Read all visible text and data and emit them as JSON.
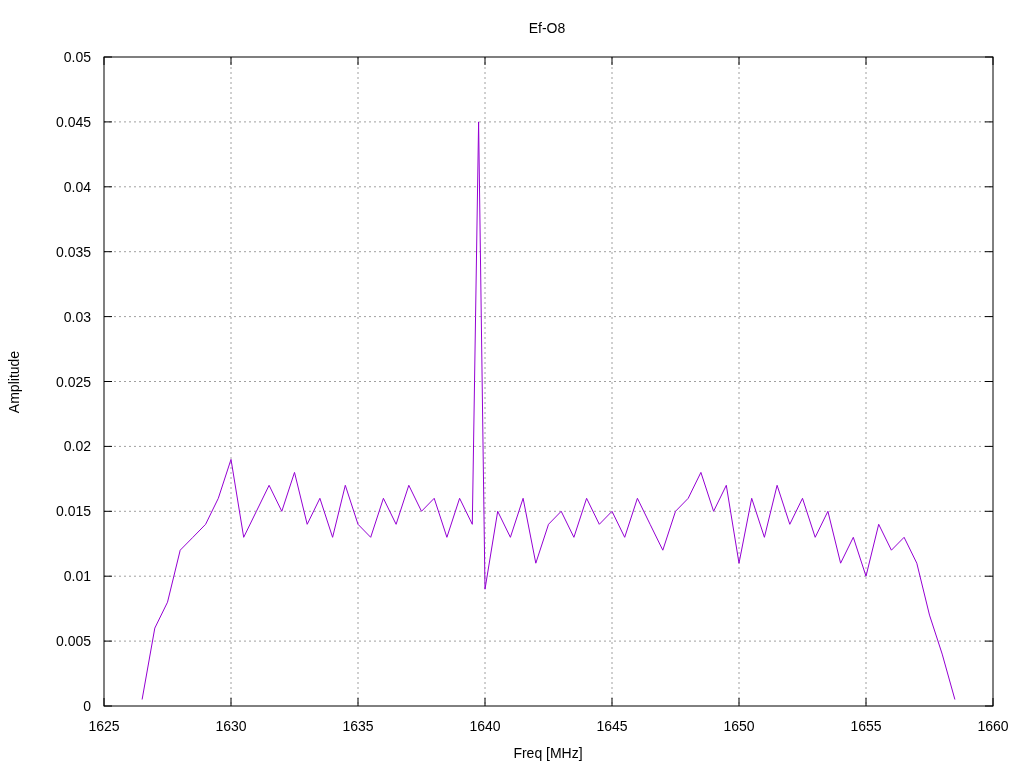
{
  "chart": {
    "chart_data": {
      "type": "line",
      "title": "Ef-O8",
      "xlabel": "Freq [MHz]",
      "ylabel": "Amplitude",
      "grid": true,
      "xlim": [
        1625,
        1660
      ],
      "ylim": [
        0,
        0.05
      ],
      "xticks": [
        1625,
        1630,
        1635,
        1640,
        1645,
        1650,
        1655,
        1660
      ],
      "yticks": [
        {
          "value": 0,
          "label": "0"
        },
        {
          "value": 0.005,
          "label": "0.005"
        },
        {
          "value": 0.01,
          "label": "0.01"
        },
        {
          "value": 0.015,
          "label": "0.015"
        },
        {
          "value": 0.02,
          "label": "0.02"
        },
        {
          "value": 0.025,
          "label": "0.025"
        },
        {
          "value": 0.03,
          "label": "0.03"
        },
        {
          "value": 0.035,
          "label": "0.035"
        },
        {
          "value": 0.04,
          "label": "0.04"
        },
        {
          "value": 0.045,
          "label": "0.045"
        },
        {
          "value": 0.05,
          "label": "0.05"
        }
      ],
      "x": [
        1626.5,
        1627,
        1627.5,
        1628,
        1628.5,
        1629,
        1629.5,
        1630,
        1630.5,
        1631,
        1631.5,
        1632,
        1632.5,
        1633,
        1633.5,
        1634,
        1634.5,
        1635,
        1635.5,
        1636,
        1636.5,
        1637,
        1637.5,
        1638,
        1638.5,
        1639,
        1639.5,
        1639.75,
        1640,
        1640.5,
        1641,
        1641.5,
        1642,
        1642.5,
        1643,
        1643.5,
        1644,
        1644.5,
        1645,
        1645.5,
        1646,
        1646.5,
        1647,
        1647.5,
        1648,
        1648.5,
        1649,
        1649.5,
        1650,
        1650.5,
        1651,
        1651.5,
        1652,
        1652.5,
        1653,
        1653.5,
        1654,
        1654.5,
        1655,
        1655.5,
        1656,
        1656.5,
        1657,
        1657.5,
        1658,
        1658.5
      ],
      "series": [
        {
          "color": "#9400d3",
          "values": [
            0.0005,
            0.006,
            0.008,
            0.012,
            0.013,
            0.014,
            0.016,
            0.019,
            0.013,
            0.015,
            0.017,
            0.015,
            0.018,
            0.014,
            0.016,
            0.013,
            0.017,
            0.014,
            0.013,
            0.016,
            0.014,
            0.017,
            0.015,
            0.016,
            0.013,
            0.016,
            0.014,
            0.045,
            0.009,
            0.015,
            0.013,
            0.016,
            0.011,
            0.014,
            0.015,
            0.013,
            0.016,
            0.014,
            0.015,
            0.013,
            0.016,
            0.014,
            0.012,
            0.015,
            0.016,
            0.018,
            0.015,
            0.017,
            0.011,
            0.016,
            0.013,
            0.017,
            0.014,
            0.016,
            0.013,
            0.015,
            0.011,
            0.013,
            0.01,
            0.014,
            0.012,
            0.013,
            0.011,
            0.007,
            0.004,
            0.0005
          ]
        }
      ]
    }
  }
}
